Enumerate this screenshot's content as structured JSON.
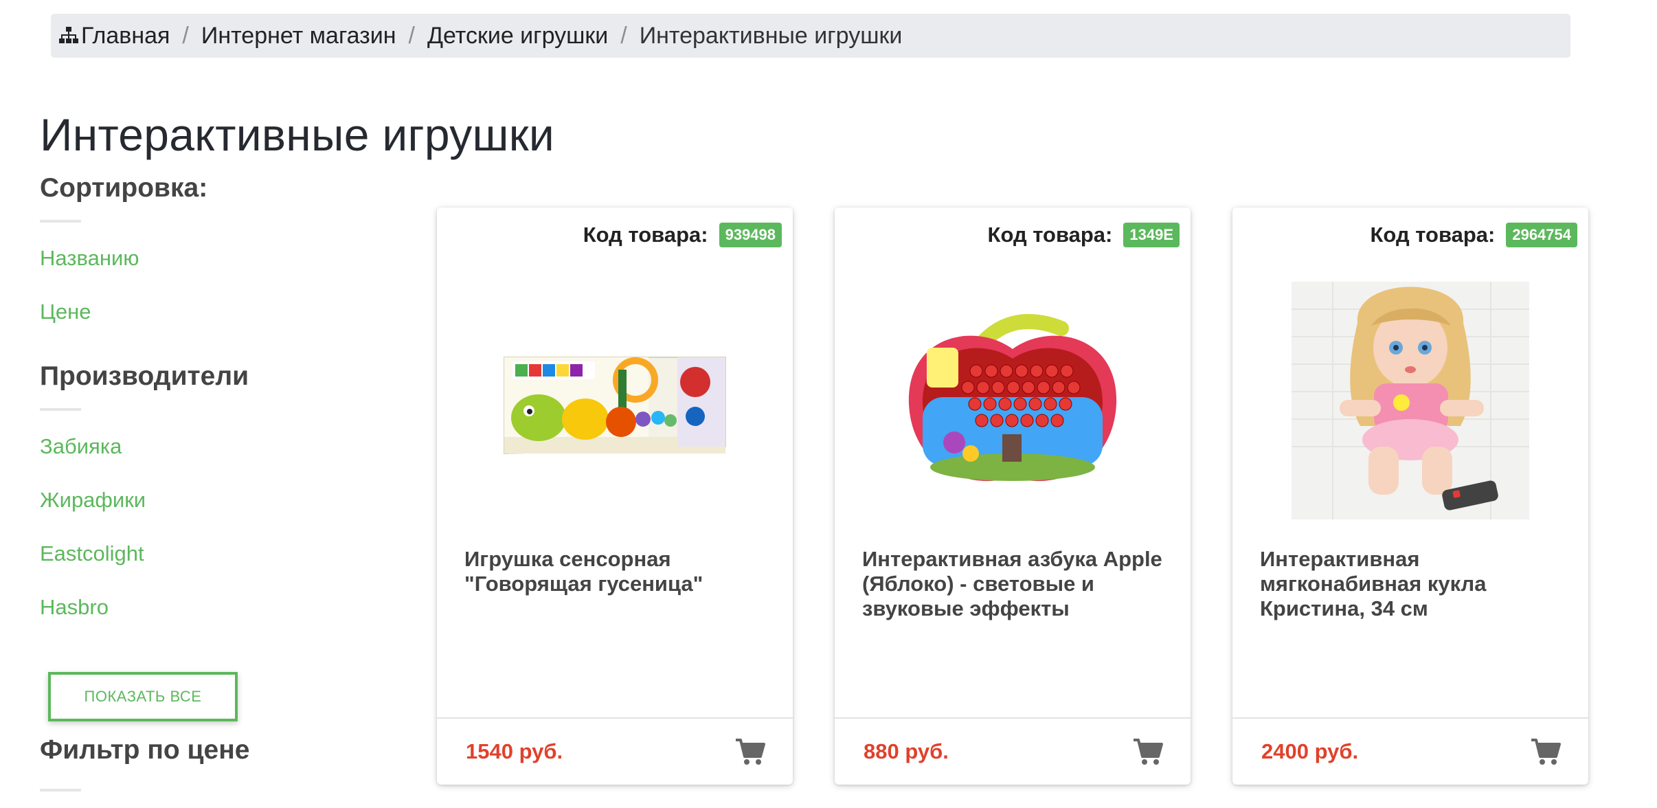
{
  "breadcrumb": {
    "items": [
      {
        "label": "Главная"
      },
      {
        "label": "Интернет магазин"
      },
      {
        "label": "Детские игрушки"
      },
      {
        "label": "Интерактивные игрушки"
      }
    ]
  },
  "page_title": "Интерактивные игрушки",
  "sidebar": {
    "sort_heading": "Сортировка:",
    "sort_options": [
      "Названию",
      "Цене"
    ],
    "manufacturers_heading": "Производители",
    "manufacturers": [
      "Забияка",
      "Жирафики",
      "Eastcolight",
      "Hasbro"
    ],
    "show_all_label": "ПОКАЗАТЬ ВСЕ",
    "price_filter_heading": "Фильтр по цене"
  },
  "products": [
    {
      "code_label": "Код товара:",
      "code": "939498",
      "name": "Игрушка сенсорная \"Говорящая гусеница\"",
      "price": "1540 руб.",
      "image_icon": "caterpillar-toy-box-image"
    },
    {
      "code_label": "Код товара:",
      "code": "1349E",
      "name": "Интерактивная азбука Apple (Яблоко) - световые и звуковые эффекты",
      "price": "880 руб.",
      "image_icon": "apple-alphabet-toy-image"
    },
    {
      "code_label": "Код товара:",
      "code": "2964754",
      "name": "Интерактивная мягконабивная кукла Кристина, 34 см",
      "price": "2400 руб.",
      "image_icon": "doll-image"
    }
  ],
  "colors": {
    "accent_green": "#5cb85c",
    "price_red": "#e0412c"
  }
}
